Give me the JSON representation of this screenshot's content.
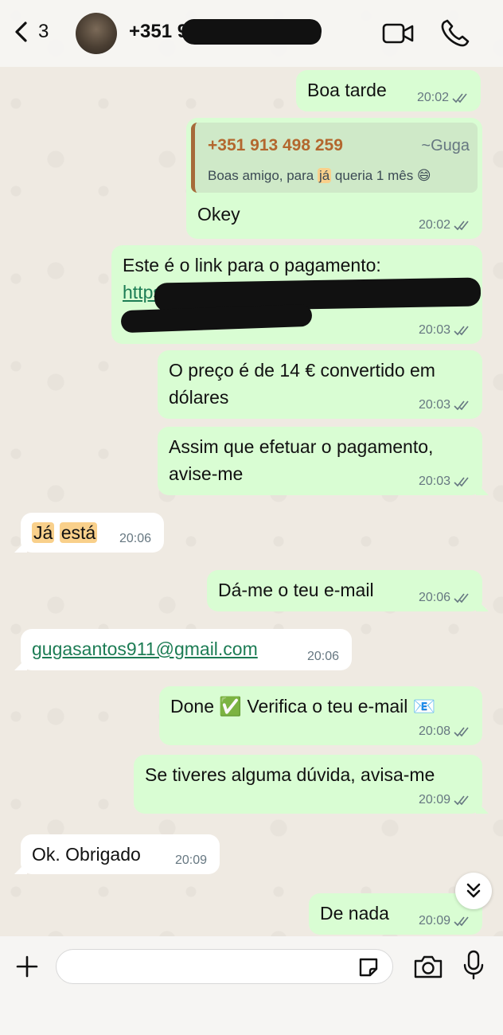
{
  "header": {
    "back_count": "3",
    "contact_name": "+351 91",
    "icons": [
      "chevron-left-icon",
      "video-camera-icon",
      "phone-icon"
    ]
  },
  "messages": [
    {
      "direction": "out",
      "text": "Boa tarde",
      "time": "20:02"
    },
    {
      "direction": "out",
      "quote": {
        "author": "+351 913 498 259",
        "alias": "~Guga",
        "text_before": "Boas amigo, para ",
        "text_highlight": "já",
        "text_after": " queria 1 mês 😄"
      },
      "text": "Okey",
      "time": "20:02"
    },
    {
      "direction": "out",
      "text": "Este é o link para o pagamento:",
      "link_visible": "https://",
      "time": "20:03"
    },
    {
      "direction": "out",
      "line1": "O preço é de 14 € convertido em",
      "line2": "dólares",
      "time": "20:03"
    },
    {
      "direction": "out",
      "line1": "Assim que efetuar o pagamento,",
      "line2": "avise-me",
      "time": "20:03"
    },
    {
      "direction": "in",
      "part1": "Já",
      "part2": "está",
      "time": "20:06"
    },
    {
      "direction": "out",
      "text": "Dá-me o teu e-mail",
      "time": "20:06"
    },
    {
      "direction": "in",
      "link": "gugasantos911@gmail.com",
      "time": "20:06"
    },
    {
      "direction": "out",
      "text": "Done ✅ Verifica o teu e-mail 📧",
      "time": "20:08"
    },
    {
      "direction": "out",
      "text": "Se tiveres alguma dúvida, avisa-me",
      "time": "20:09"
    },
    {
      "direction": "in",
      "text": "Ok. Obrigado",
      "time": "20:09"
    },
    {
      "direction": "out",
      "text": "De nada",
      "time": "20:09"
    }
  ],
  "footer": {
    "input_value": "",
    "icons": [
      "plus-icon",
      "sticker-icon",
      "camera-icon",
      "microphone-icon"
    ]
  },
  "colors": {
    "outgoing_bubble": "#d9fdd3",
    "incoming_bubble": "#ffffff",
    "read_ticks": "#667781",
    "highlight": "#f9d08b",
    "link": "#1c7c54"
  }
}
